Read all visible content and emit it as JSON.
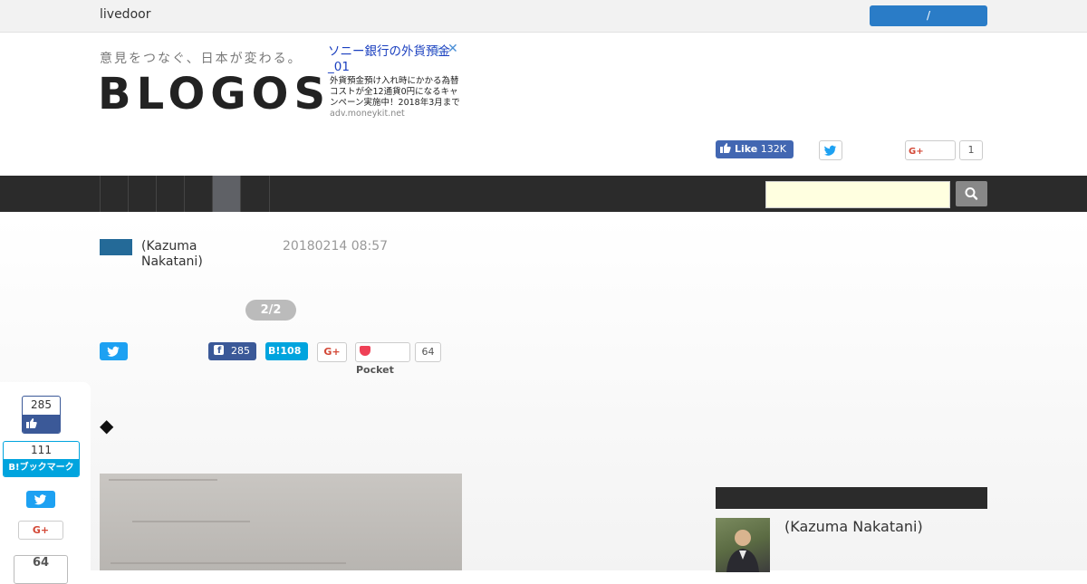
{
  "topbar": {
    "brand": "livedoor",
    "button_label": "/"
  },
  "header": {
    "tagline": "意見をつなぐ、日本が変わる。",
    "logo": "BLOGOS"
  },
  "ad": {
    "title": "ソニー銀行の外貨預金",
    "title2": "_01",
    "body": "外貨預金預け入れ時にかかる為替コストが全12通貨0円になるキャンペーン実施中！2018年3月まで",
    "domain": "adv.moneykit.net"
  },
  "header_share": {
    "fb_like_label": "Like",
    "fb_like_count": "132K",
    "gplus_count": "1"
  },
  "nav": {
    "active_index": 4
  },
  "article": {
    "author": "(Kazuma Nakatani)",
    "date": "20180214 08:57",
    "pager": "2/2",
    "diamond": "◆"
  },
  "share": {
    "facebook_count": "285",
    "hatena_label": "B!",
    "hatena_count": "108",
    "gplus_label": "G+",
    "pocket_label": "Pocket",
    "pocket_count": "64"
  },
  "floating_share": {
    "facebook_count": "285",
    "hatena_count": "111",
    "hatena_label": "B!ブックマーク",
    "gplus_label": "G+",
    "pocket_count": "64"
  },
  "sidebar": {
    "author_name": "(Kazuma Nakatani)"
  },
  "colors": {
    "facebook": "#3b5998",
    "twitter": "#1da1f2",
    "hatena": "#00a4de",
    "nav_bg": "#2b2b2b",
    "livedoor_btn": "#2a7cc7"
  }
}
